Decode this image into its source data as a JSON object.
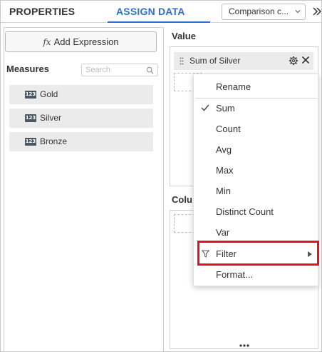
{
  "header": {
    "tabs": [
      "PROPERTIES",
      "ASSIGN DATA"
    ],
    "active_tab": "ASSIGN DATA",
    "widget_select": "Comparison c...",
    "accent_color": "#2f6fd1"
  },
  "left_panel": {
    "add_expression_label": "Add Expression",
    "add_expression_icon": "fx",
    "measures_label": "Measures",
    "search_placeholder": "Search",
    "fields": [
      {
        "icon": "123",
        "name": "Gold"
      },
      {
        "icon": "123",
        "name": "Silver"
      },
      {
        "icon": "123",
        "name": "Bronze"
      }
    ]
  },
  "value_section": {
    "label": "Value",
    "chip_label": "Sum of Silver"
  },
  "column_section": {
    "label": "Colu"
  },
  "context_menu": {
    "items": [
      "Rename",
      "Sum",
      "Count",
      "Avg",
      "Max",
      "Min",
      "Distinct Count",
      "Var",
      "Filter",
      "Format..."
    ],
    "checked_item": "Sum",
    "submenu_item": "Filter",
    "highlight_color": "#e0141c"
  }
}
